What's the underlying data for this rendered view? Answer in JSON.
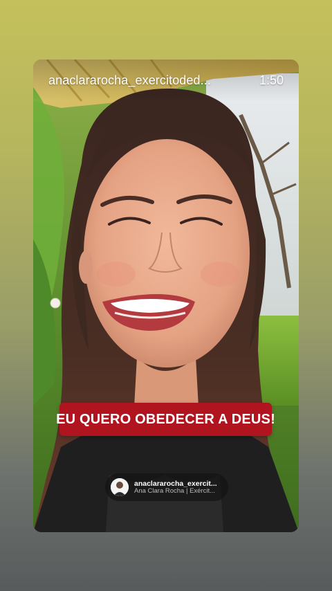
{
  "story": {
    "username": "anaclararocha_exercitoded...",
    "time": "1:50"
  },
  "caption": {
    "text": "EU QUERO OBEDECER A DEUS!",
    "background_color": "#b0141f"
  },
  "profile_pill": {
    "username": "anaclararocha_exercit...",
    "display_name": "Ana Clara Rocha | Exércit..."
  },
  "colors": {
    "page_gradient_top": "#c4c05c",
    "page_gradient_bottom": "#575b5c"
  }
}
